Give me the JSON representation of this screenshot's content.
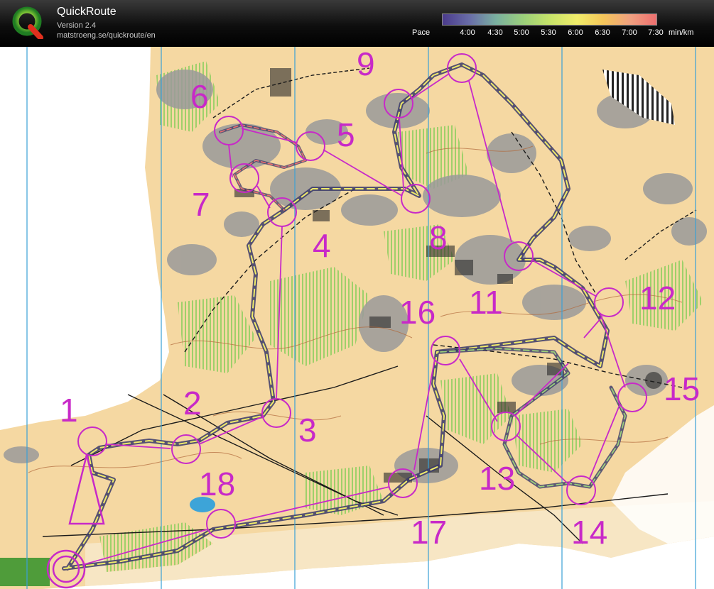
{
  "app": {
    "title": "QuickRoute",
    "version": "Version 2.4",
    "url": "matstroeng.se/quickroute/en"
  },
  "pace_legend": {
    "label": "Pace",
    "ticks": [
      "4:00",
      "4:30",
      "5:00",
      "5:30",
      "6:00",
      "6:30",
      "7:00",
      "7:30"
    ],
    "unit": "min/km",
    "colors": [
      "#4b3b8c",
      "#6a6fa8",
      "#7ab0a0",
      "#9cd07a",
      "#c6e36a",
      "#f0ec6a",
      "#f4c65a",
      "#f0a080",
      "#ee6f6f"
    ]
  },
  "map": {
    "controls": [
      "1",
      "2",
      "3",
      "4",
      "5",
      "6",
      "7",
      "8",
      "9",
      "11",
      "12",
      "13",
      "14",
      "15",
      "16",
      "17",
      "18"
    ],
    "colors": {
      "course": "#c829c8",
      "open_land": "#f5d8a2",
      "forest": "#ffffff",
      "green": "#a6d66e",
      "rock": "#9a9a9a",
      "meridian": "#3aa0d6",
      "route": "#4a4a7a"
    }
  }
}
